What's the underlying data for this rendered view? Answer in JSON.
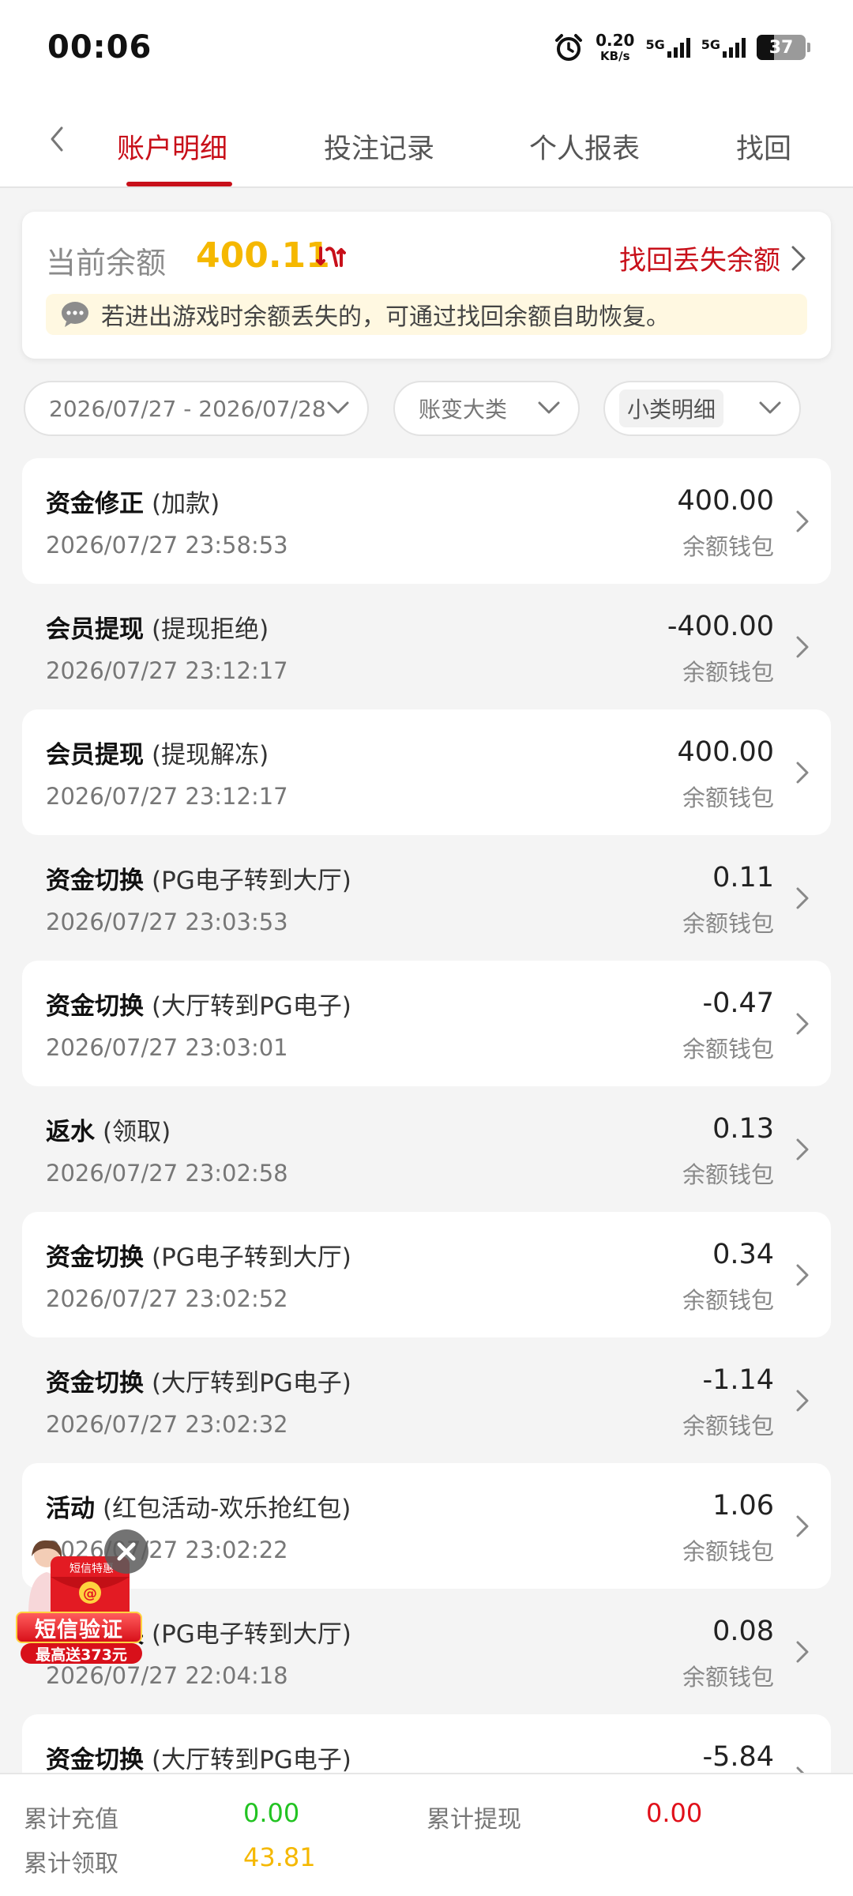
{
  "status_bar": {
    "time": "00:06",
    "net_speed": "0.20",
    "net_unit": "KB/s",
    "sim1": "5G",
    "sim2": "5G",
    "battery": "37"
  },
  "tabs": [
    {
      "label": "账户明细",
      "active": true
    },
    {
      "label": "投注记录",
      "active": false
    },
    {
      "label": "个人报表",
      "active": false
    },
    {
      "label": "找回",
      "active": false
    }
  ],
  "balance": {
    "label": "当前余额",
    "amount": "400.11",
    "recover_label": "找回丢失余额",
    "notice": "若进出游戏时余额丢失的，可通过找回余额自助恢复。"
  },
  "filters": {
    "date_range": "2026/07/27 - 2026/07/28",
    "category": "账变大类",
    "subcategory": "小类明细"
  },
  "transactions": [
    {
      "type": "资金修正",
      "detail": "(加款)",
      "time": "2026/07/27 23:58:53",
      "amount": "400.00",
      "wallet": "余额钱包"
    },
    {
      "type": "会员提现",
      "detail": "(提现拒绝)",
      "time": "2026/07/27 23:12:17",
      "amount": "-400.00",
      "wallet": "余额钱包"
    },
    {
      "type": "会员提现",
      "detail": "(提现解冻)",
      "time": "2026/07/27 23:12:17",
      "amount": "400.00",
      "wallet": "余额钱包"
    },
    {
      "type": "资金切换",
      "detail": "(PG电子转到大厅)",
      "time": "2026/07/27 23:03:53",
      "amount": "0.11",
      "wallet": "余额钱包"
    },
    {
      "type": "资金切换",
      "detail": "(大厅转到PG电子)",
      "time": "2026/07/27 23:03:01",
      "amount": "-0.47",
      "wallet": "余额钱包"
    },
    {
      "type": "返水",
      "detail": "(领取)",
      "time": "2026/07/27 23:02:58",
      "amount": "0.13",
      "wallet": "余额钱包"
    },
    {
      "type": "资金切换",
      "detail": "(PG电子转到大厅)",
      "time": "2026/07/27 23:02:52",
      "amount": "0.34",
      "wallet": "余额钱包"
    },
    {
      "type": "资金切换",
      "detail": "(大厅转到PG电子)",
      "time": "2026/07/27 23:02:32",
      "amount": "-1.14",
      "wallet": "余额钱包"
    },
    {
      "type": "活动",
      "detail": "(红包活动-欢乐抢红包)",
      "time": "2026/07/27 23:02:22",
      "amount": "1.06",
      "wallet": "余额钱包"
    },
    {
      "type": "资金切换",
      "detail": "(PG电子转到大厅)",
      "time": "2026/07/27 22:04:18",
      "amount": "0.08",
      "wallet": "余额钱包"
    },
    {
      "type": "资金切换",
      "detail": "(大厅转到PG电子)",
      "time": "",
      "amount": "-5.84",
      "wallet": ""
    }
  ],
  "summary": {
    "total_recharge_label": "累计充值",
    "total_recharge": "0.00",
    "total_withdraw_label": "累计提现",
    "total_withdraw": "0.00",
    "total_claim_label": "累计领取",
    "total_claim": "43.81"
  },
  "promo": {
    "tag": "短信特惠",
    "title": "短信验证",
    "subtitle": "最高送373元"
  },
  "colors": {
    "accent_red": "#c8101a",
    "balance_gold": "#f5b800",
    "recharge_green": "#22c322",
    "withdraw_red": "#e0101a",
    "claim_gold": "#f5b800"
  }
}
